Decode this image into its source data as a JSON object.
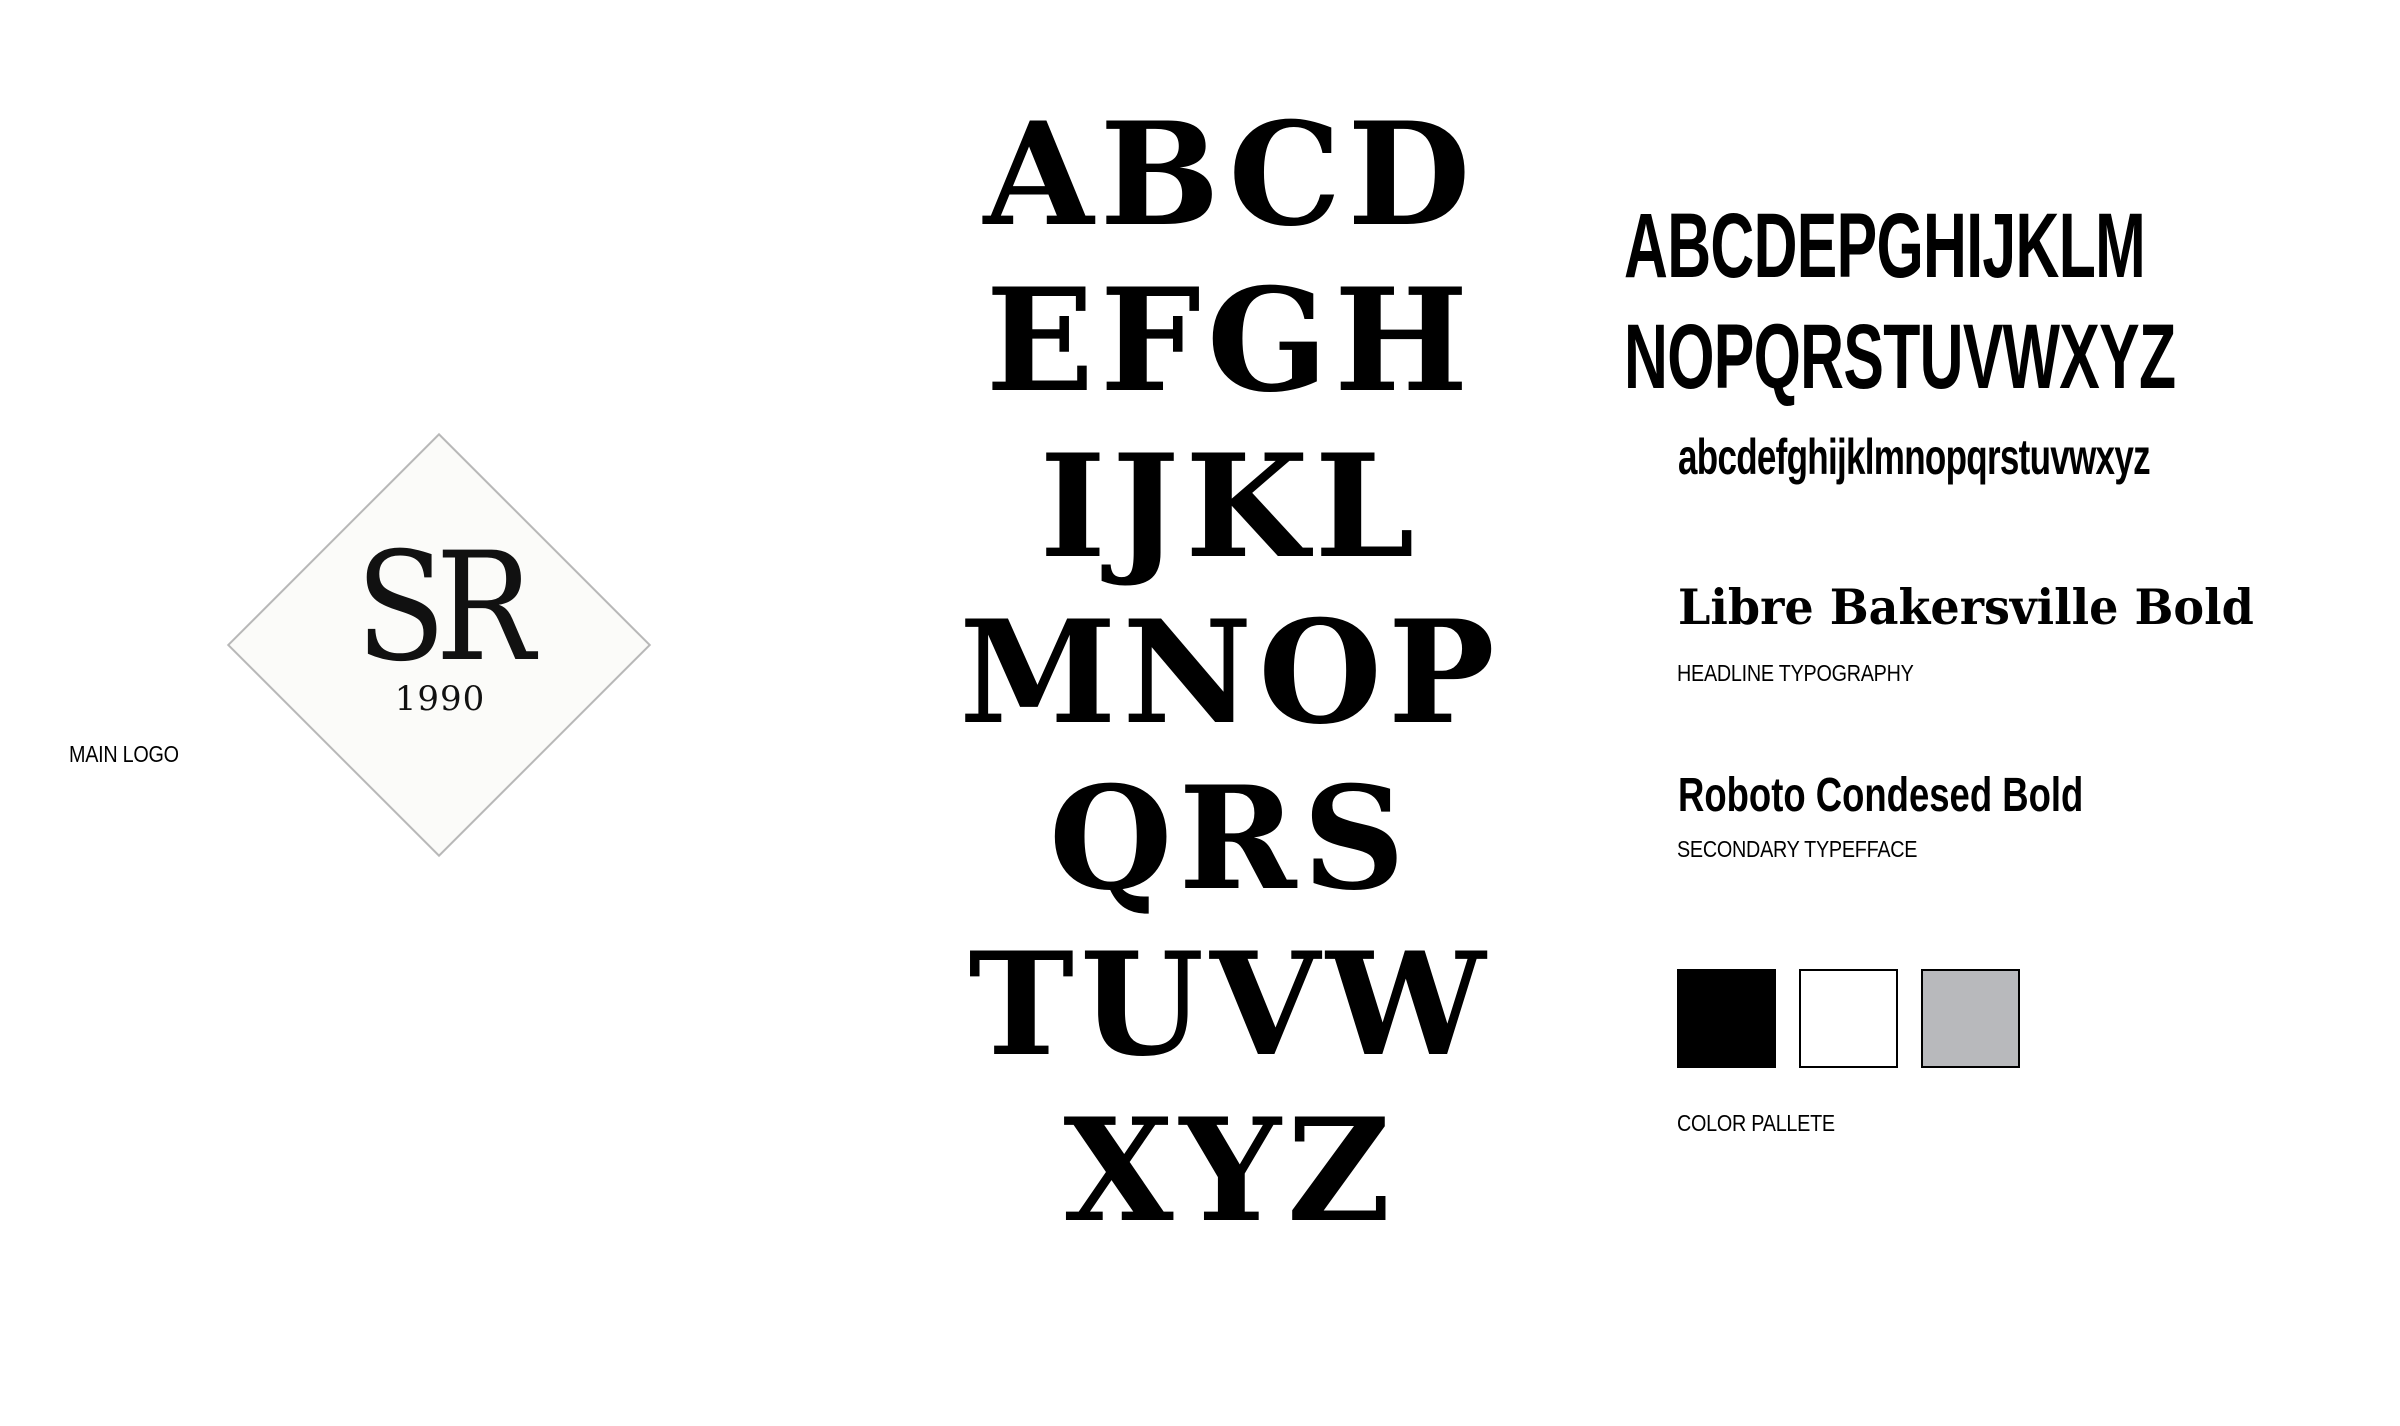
{
  "logo": {
    "label": "MAIN LOGO",
    "monogram": "SR",
    "year": "1990"
  },
  "serif_specimen": {
    "rows": [
      "ABCD",
      "EFGH",
      "IJKL",
      "MNOP",
      "QRS",
      "TUVW",
      "XYZ"
    ]
  },
  "sans_specimen": {
    "uppercase_line1": "ABCDEPGHIJKLM",
    "uppercase_line2": "NOPQRSTUVWXYZ",
    "lowercase": "abcdefghijklmnopqrstuvwxyz"
  },
  "fonts": {
    "headline": {
      "name": "Libre Bakersville Bold",
      "caption": "HEADLINE TYPOGRAPHY"
    },
    "secondary": {
      "name": "Roboto Condesed Bold",
      "caption": "SECONDARY TYPEFFACE"
    }
  },
  "palette": {
    "label": "COLOR PALLETE",
    "colors": [
      "#000000",
      "#FFFFFF",
      "#B8B9BC"
    ]
  }
}
